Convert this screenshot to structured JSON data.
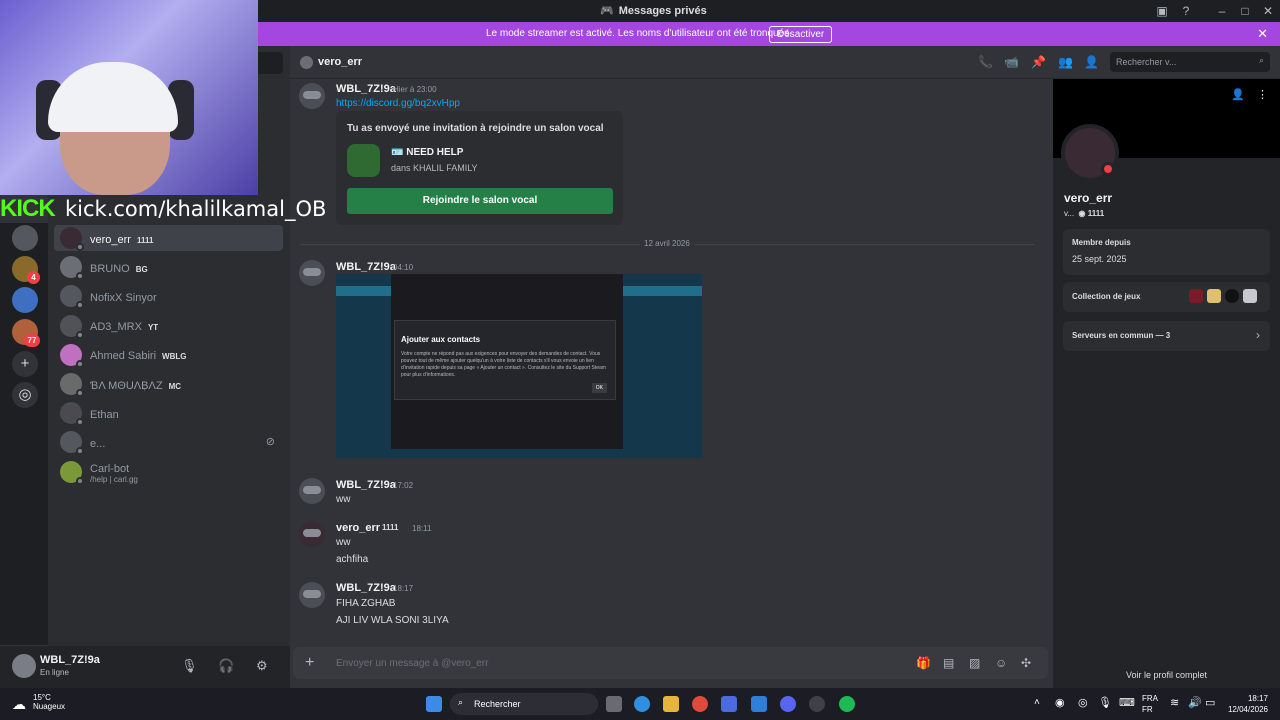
{
  "window": {
    "title": "Messages privés"
  },
  "banner": {
    "text": "Le mode streamer est activé. Les noms d'utilisateur ont été tronqués.",
    "button": "Désactiver"
  },
  "overlay": {
    "brand": "KICK",
    "url": "kick.com/khalilkamal_OB"
  },
  "servers": {
    "badge_1": "4",
    "badge_2": "77"
  },
  "dm_list": [
    {
      "name": "vero_err",
      "tag": "1111",
      "active": true
    },
    {
      "name": "BRUNO",
      "tag": "BG"
    },
    {
      "name": "NofixX Sinyor",
      "tag": ""
    },
    {
      "name": "AD3_MRX",
      "tag": "YT"
    },
    {
      "name": "Ahmed Sabiri",
      "tag": "WBLG"
    },
    {
      "name": "ƁΛ MΘUΛḄΛZ",
      "tag": "MC"
    },
    {
      "name": "Ethan",
      "tag": ""
    },
    {
      "name": "e...",
      "tag": ""
    },
    {
      "name": "Carl-bot",
      "sub": "/help | carl.gg"
    }
  ],
  "user_panel": {
    "name": "WBL_7Z!9a",
    "status": "En ligne"
  },
  "chat_header": {
    "name": "vero_err",
    "search_placeholder": "Rechercher v..."
  },
  "messages": {
    "m1": {
      "author": "WBL_7Z!9a",
      "time": "Hier à 23:00",
      "link": "https://discord.gg/bq2xvHpp"
    },
    "invite": {
      "header": "Tu as envoyé une invitation à rejoindre un salon vocal",
      "channel": "🪪 NEED HELP",
      "guild": "dans KHALIL FAMILY",
      "button": "Rejoindre le salon vocal"
    },
    "date_divider": "12 avril 2026",
    "m2": {
      "author": "WBL_7Z!9a",
      "time": "04:10"
    },
    "screenshot": {
      "dialog_title": "Ajouter aux contacts",
      "dialog_body": "Votre compte ne répond pas aux exigences pour envoyer des demandes de contact. Vous pouvez tout de même ajouter quelqu'un à votre liste de contacts s'il vous envoie un lien d'invitation rapide depuis sa page « Ajouter un contact ». Consultez le site du Support Steam pour plus d'informations.",
      "ok": "OK"
    },
    "m3": {
      "author": "WBL_7Z!9a",
      "time": "17:02",
      "text": "ww"
    },
    "m4": {
      "author": "vero_err",
      "tag": "1111",
      "time": "18:11",
      "text1": "ww",
      "text2": "achfiha"
    },
    "m5": {
      "author": "WBL_7Z!9a",
      "time": "18:17",
      "text1": "FIHA ZGHAB",
      "text2": "AJI LIV WLA SONI 3LIYA"
    }
  },
  "composer": {
    "placeholder": "Envoyer un message à @vero_err"
  },
  "profile": {
    "name": "vero_err",
    "short": "v...",
    "tag": "1111",
    "member_since_label": "Membre depuis",
    "member_since": "25 sept. 2025",
    "games_label": "Collection de jeux",
    "servers_label": "Serveurs en commun — 3",
    "full_profile": "Voir le profil complet"
  },
  "taskbar": {
    "temp": "15°C",
    "weather": "Nuageux",
    "search": "Rechercher",
    "lang1": "FRA",
    "lang2": "FR",
    "time": "18:17",
    "date": "12/04/2026"
  }
}
